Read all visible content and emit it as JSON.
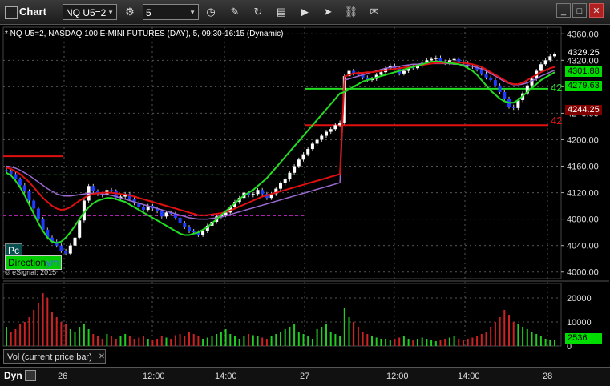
{
  "window": {
    "title": "Chart"
  },
  "toolbar": {
    "symbol_value": "NQ U5=2",
    "interval_value": "5",
    "tools": [
      "gear-icon",
      "clock-icon",
      "pencil-icon",
      "refresh-icon",
      "chart-icon",
      "play-icon",
      "cursor-icon",
      "link-icon",
      "note-icon"
    ]
  },
  "chart": {
    "header": "* NQ U5=2, NASDAQ 100 E-MINI FUTURES (DAY), 5, 09:30-16:15 (Dynamic)",
    "price_axis": [
      "4360.00",
      "4320.00",
      "4280.00",
      "4240.00",
      "4200.00",
      "4160.00",
      "4120.00",
      "4080.00",
      "4040.00",
      "4000.00"
    ],
    "price_labels": [
      {
        "text": "4329.25",
        "color": "#ffffff",
        "bg": "#000000"
      },
      {
        "text": "4301.88",
        "color": "#000000",
        "bg": "#00dd00"
      },
      {
        "text": "4279.63",
        "color": "#000000",
        "bg": "#00dd00"
      },
      {
        "text": "4244.25",
        "color": "#ffffff",
        "bg": "#800000"
      }
    ],
    "counters": [
      "42",
      "42"
    ],
    "time_axis": [
      "26",
      "12:00",
      "14:00",
      "27",
      "12:00",
      "14:00",
      "28"
    ],
    "badges": {
      "pc": "Pc",
      "direction": "Direction",
      "direction_suffix": "ym"
    },
    "copyright": "© eSignal, 2015",
    "colors": {
      "up": "#ffffff",
      "down": "#1e3cff",
      "ma_red": "#e01010",
      "ma_green": "#22dd22",
      "ma_purple": "#9a6ad0",
      "grid": "#555555"
    }
  },
  "volume": {
    "label": "Vol (current price bar)",
    "axis": [
      "20000",
      "10000",
      "0"
    ],
    "current_value": "2536"
  },
  "footer": {
    "mode": "Dyn"
  },
  "chart_data": {
    "type": "candlestick",
    "title": "* NQ U5=2, NASDAQ 100 E-MINI FUTURES (DAY), 5, 09:30-16:15 (Dynamic)",
    "ylim": [
      3990,
      4370
    ],
    "y_ticks": [
      4000,
      4040,
      4080,
      4120,
      4160,
      4200,
      4240,
      4280,
      4320,
      4360
    ],
    "x_labels": [
      "26",
      "12:00",
      "14:00",
      "27",
      "12:00",
      "14:00",
      "28"
    ],
    "closes": [
      4152,
      4148,
      4140,
      4131,
      4122,
      4108,
      4096,
      4080,
      4064,
      4052,
      4046,
      4040,
      4032,
      4028,
      4040,
      4052,
      4078,
      4108,
      4130,
      4122,
      4118,
      4116,
      4124,
      4122,
      4112,
      4114,
      4118,
      4110,
      4104,
      4098,
      4094,
      4100,
      4096,
      4092,
      4084,
      4090,
      4088,
      4082,
      4074,
      4068,
      4062,
      4060,
      4056,
      4062,
      4070,
      4076,
      4084,
      4086,
      4090,
      4098,
      4106,
      4112,
      4120,
      4116,
      4118,
      4124,
      4118,
      4112,
      4118,
      4126,
      4134,
      4140,
      4150,
      4160,
      4170,
      4178,
      4186,
      4194,
      4200,
      4206,
      4212,
      4216,
      4222,
      4226,
      4296,
      4304,
      4300,
      4298,
      4294,
      4290,
      4292,
      4298,
      4302,
      4308,
      4312,
      4308,
      4300,
      4304,
      4310,
      4308,
      4312,
      4316,
      4320,
      4322,
      4324,
      4318,
      4316,
      4320,
      4322,
      4318,
      4316,
      4312,
      4310,
      4306,
      4300,
      4294,
      4290,
      4282,
      4272,
      4262,
      4250,
      4248,
      4260,
      4270,
      4282,
      4292,
      4304,
      4314,
      4320,
      4326,
      4329
    ],
    "ma_red": [
      4158,
      4156,
      4152,
      4148,
      4142,
      4136,
      4128,
      4120,
      4112,
      4106,
      4100,
      4096,
      4094,
      4095,
      4098,
      4103,
      4108,
      4112,
      4116,
      4118,
      4119,
      4120,
      4120,
      4120,
      4119,
      4118,
      4117,
      4116,
      4114,
      4112,
      4110,
      4108,
      4106,
      4104,
      4102,
      4100,
      4098,
      4096,
      4094,
      4092,
      4090,
      4088,
      4086,
      4086,
      4086,
      4087,
      4088,
      4089,
      4091,
      4093,
      4096,
      4099,
      4102,
      4105,
      4108,
      4111,
      4114,
      4116,
      4118,
      4120,
      4122,
      4124,
      4126,
      4128,
      4130,
      4132,
      4134,
      4136,
      4138,
      4140,
      4142,
      4144,
      4146,
      4148,
      4295,
      4298,
      4300,
      4301,
      4301,
      4302,
      4302,
      4303,
      4304,
      4305,
      4306,
      4307,
      4308,
      4309,
      4310,
      4311,
      4312,
      4313,
      4314,
      4315,
      4316,
      4316,
      4316,
      4317,
      4317,
      4317,
      4316,
      4315,
      4314,
      4312,
      4310,
      4306,
      4302,
      4298,
      4294,
      4290,
      4286,
      4284,
      4284,
      4286,
      4290,
      4294,
      4298,
      4302,
      4305,
      4308,
      4310
    ],
    "ma_green": [
      4150,
      4146,
      4138,
      4128,
      4116,
      4102,
      4088,
      4074,
      4062,
      4052,
      4046,
      4044,
      4046,
      4052,
      4060,
      4070,
      4080,
      4090,
      4098,
      4104,
      4108,
      4110,
      4112,
      4112,
      4110,
      4108,
      4106,
      4102,
      4098,
      4094,
      4090,
      4086,
      4082,
      4078,
      4074,
      4070,
      4066,
      4062,
      4058,
      4056,
      4056,
      4058,
      4060,
      4064,
      4068,
      4074,
      4080,
      4086,
      4092,
      4098,
      4104,
      4110,
      4116,
      4120,
      4124,
      4130,
      4136,
      4142,
      4150,
      4158,
      4166,
      4174,
      4182,
      4190,
      4198,
      4206,
      4214,
      4222,
      4230,
      4238,
      4246,
      4254,
      4262,
      4270,
      4272,
      4276,
      4280,
      4284,
      4288,
      4290,
      4292,
      4294,
      4296,
      4298,
      4300,
      4302,
      4304,
      4306,
      4308,
      4310,
      4312,
      4314,
      4316,
      4318,
      4318,
      4318,
      4317,
      4316,
      4315,
      4314,
      4312,
      4308,
      4304,
      4298,
      4290,
      4282,
      4274,
      4268,
      4262,
      4258,
      4256,
      4256,
      4260,
      4266,
      4272,
      4278,
      4284,
      4290,
      4294,
      4298,
      4302
    ],
    "ma_purple": [
      4160,
      4159,
      4157,
      4154,
      4150,
      4146,
      4141,
      4136,
      4131,
      4126,
      4122,
      4118,
      4116,
      4115,
      4115,
      4116,
      4117,
      4118,
      4119,
      4119,
      4119,
      4118,
      4117,
      4116,
      4114,
      4112,
      4110,
      4108,
      4106,
      4104,
      4102,
      4100,
      4098,
      4096,
      4094,
      4092,
      4090,
      4088,
      4086,
      4084,
      4082,
      4081,
      4080,
      4080,
      4080,
      4081,
      4082,
      4083,
      4085,
      4087,
      4089,
      4091,
      4093,
      4095,
      4097,
      4099,
      4101,
      4103,
      4105,
      4107,
      4109,
      4111,
      4113,
      4115,
      4117,
      4119,
      4121,
      4123,
      4125,
      4127,
      4129,
      4131,
      4133,
      4135,
      4290,
      4292,
      4294,
      4296,
      4298,
      4300,
      4302,
      4304,
      4306,
      4308,
      4309,
      4310,
      4311,
      4312,
      4313,
      4314,
      4314,
      4315,
      4315,
      4315,
      4315,
      4315,
      4315,
      4315,
      4314,
      4314,
      4313,
      4312,
      4311,
      4309,
      4307,
      4304,
      4300,
      4296,
      4292,
      4288,
      4285,
      4283,
      4283,
      4284,
      4286,
      4289,
      4292,
      4296,
      4299,
      4302,
      4305
    ],
    "volumes": [
      8000,
      6000,
      7000,
      9000,
      10000,
      12000,
      15000,
      18000,
      22000,
      20000,
      14000,
      12000,
      10000,
      9000,
      7000,
      6000,
      8000,
      9000,
      7000,
      5000,
      4000,
      3000,
      5000,
      4000,
      3000,
      4000,
      5000,
      4000,
      3000,
      3500,
      4000,
      3000,
      2500,
      3000,
      4000,
      3500,
      3000,
      4500,
      5000,
      4000,
      6000,
      5000,
      4000,
      3000,
      3500,
      4000,
      5000,
      6000,
      7000,
      5000,
      4000,
      3000,
      4000,
      5000,
      4500,
      4000,
      3500,
      3000,
      4000,
      5000,
      6000,
      7000,
      8000,
      9000,
      6000,
      5000,
      4000,
      3000,
      7000,
      8000,
      9000,
      6000,
      5000,
      4000,
      16000,
      12000,
      10000,
      8000,
      6000,
      5000,
      4000,
      3500,
      3000,
      3000,
      2500,
      3000,
      3500,
      4000,
      3000,
      2500,
      3000,
      3500,
      3000,
      2500,
      2000,
      2500,
      3000,
      3500,
      4000,
      3000,
      2500,
      3000,
      3500,
      4000,
      5000,
      6000,
      8000,
      10000,
      12000,
      15000,
      13000,
      10000,
      9000,
      8000,
      7000,
      6000,
      5000,
      4000,
      3000,
      2536,
      2536
    ]
  }
}
